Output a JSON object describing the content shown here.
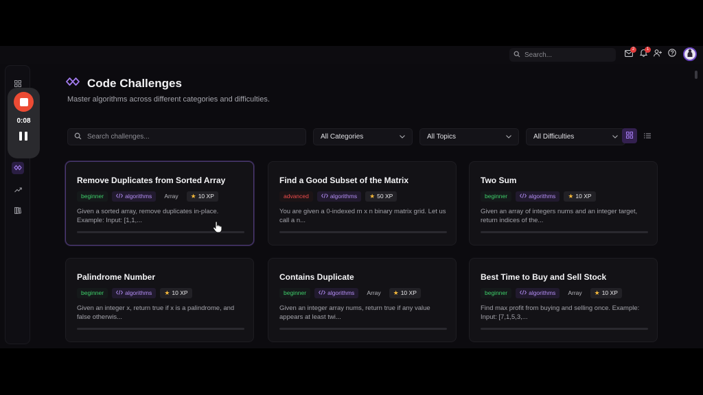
{
  "topbar": {
    "search_placeholder": "Search...",
    "mail_badge": "2",
    "notif_badge": "1"
  },
  "recorder": {
    "time": "0:08"
  },
  "page": {
    "title": "Code Challenges",
    "subtitle": "Master algorithms across different categories and difficulties."
  },
  "filters": {
    "search_placeholder": "Search challenges...",
    "category": "All Categories",
    "topic": "All Topics",
    "difficulty": "All Difficulties"
  },
  "colors": {
    "accent": "#8b5cf6",
    "beginner": "#3ecf6a",
    "advanced": "#ef4b4b",
    "record": "#ec4b34"
  },
  "cards": [
    {
      "title": "Remove Duplicates from Sorted Array",
      "difficulty": "beginner",
      "category": "algorithms",
      "topic": "Array",
      "xp": "10 XP",
      "description": "Given a sorted array, remove duplicates in-place. Example: Input: [1,1,..."
    },
    {
      "title": "Find a Good Subset of the Matrix",
      "difficulty": "advanced",
      "category": "algorithms",
      "topic": "",
      "xp": "50 XP",
      "description": "You are given a 0-indexed m x n binary matrix grid. Let us call a n..."
    },
    {
      "title": "Two Sum",
      "difficulty": "beginner",
      "category": "algorithms",
      "topic": "",
      "xp": "10 XP",
      "description": "Given an array of integers nums and an integer target, return indices of the..."
    },
    {
      "title": "Palindrome Number",
      "difficulty": "beginner",
      "category": "algorithms",
      "topic": "",
      "xp": "10 XP",
      "description": "Given an integer x, return true if x is a palindrome, and false otherwis..."
    },
    {
      "title": "Contains Duplicate",
      "difficulty": "beginner",
      "category": "algorithms",
      "topic": "Array",
      "xp": "10 XP",
      "description": "Given an integer array nums, return true if any value appears at least twi..."
    },
    {
      "title": "Best Time to Buy and Sell Stock",
      "difficulty": "beginner",
      "category": "algorithms",
      "topic": "Array",
      "xp": "10 XP",
      "description": "Find max profit from buying and selling once. Example: Input: [7,1,5,3,..."
    }
  ]
}
